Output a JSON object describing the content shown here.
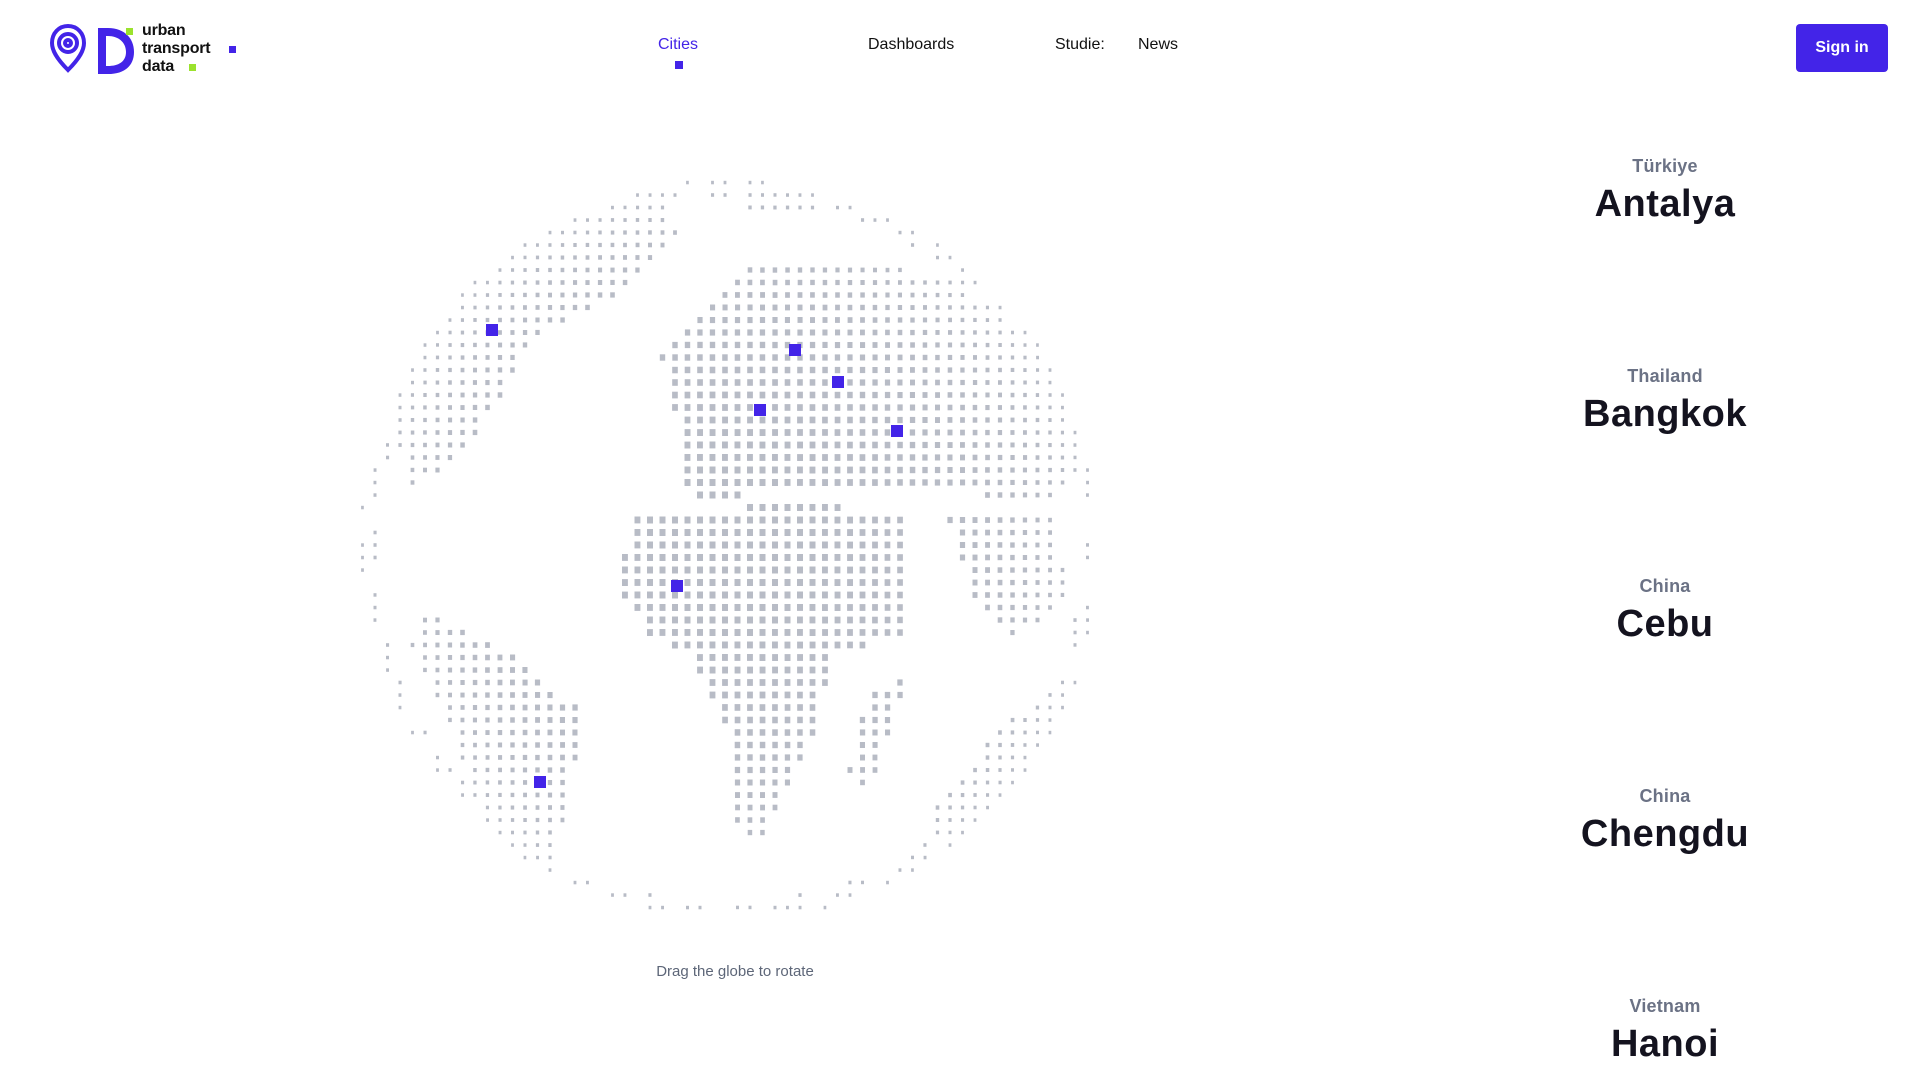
{
  "brand": {
    "lines": [
      "urban",
      "transport",
      "data"
    ],
    "colors": {
      "primary": "#4324e8",
      "accent": "#9be22d"
    }
  },
  "nav": {
    "items": [
      {
        "label": "Cities",
        "active": true
      },
      {
        "label": "Dashboards",
        "active": false
      },
      {
        "label": "Studie:",
        "active": false
      },
      {
        "label": "News",
        "active": false
      }
    ]
  },
  "auth": {
    "signin_label": "Sign in"
  },
  "globe": {
    "hint": "Drag the globe to rotate",
    "icon": "dotted-world-globe",
    "marker_color": "#4324e8",
    "land_color": "#b8bcc6"
  },
  "cities": [
    {
      "country": "Türkiye",
      "name": "Antalya"
    },
    {
      "country": "Thailand",
      "name": "Bangkok"
    },
    {
      "country": "China",
      "name": "Cebu"
    },
    {
      "country": "China",
      "name": "Chengdu"
    },
    {
      "country": "Vietnam",
      "name": "Hanoi"
    }
  ]
}
